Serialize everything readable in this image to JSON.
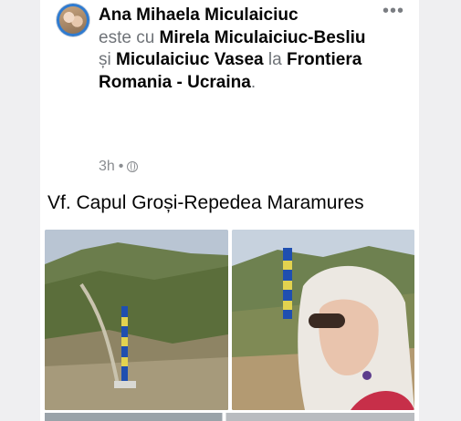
{
  "post": {
    "author": "Ana Mihaela Miculaiciuc",
    "with_label": "este cu",
    "tagged_1": "Mirela Miculaiciuc-Besliu",
    "and_label": "și",
    "tagged_2": "Miculaiciuc Vasea",
    "at_label": "la",
    "location": "Frontiera Romania - Ucraina",
    "period": ".",
    "time": "3h",
    "dot": "•",
    "privacy_icon": "globe-icon",
    "more_icon": "more-horizontal-icon",
    "more_label": "•••",
    "caption": "Vf. Capul Groși-Repedea Maramures"
  },
  "photos": [
    {
      "description_icon": "landscape-photo",
      "accent": "#1f4fb0"
    },
    {
      "description_icon": "selfie-photo",
      "accent": "#d6c84a"
    }
  ],
  "colors": {
    "background": "#efeff1",
    "card": "#ffffff",
    "text": "#050505",
    "secondary": "#6f7378"
  }
}
